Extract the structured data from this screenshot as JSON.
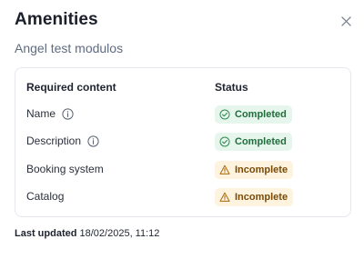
{
  "dialog": {
    "title": "Amenities",
    "subtitle": "Angel test modulos",
    "close_icon": "close-icon"
  },
  "table": {
    "headers": {
      "required_content": "Required content",
      "status": "Status"
    },
    "rows": [
      {
        "label": "Name",
        "has_info": true,
        "status": "Completed",
        "status_type": "success",
        "icon": "check-circle-icon"
      },
      {
        "label": "Description",
        "has_info": true,
        "status": "Completed",
        "status_type": "success",
        "icon": "check-circle-icon"
      },
      {
        "label": "Booking system",
        "has_info": false,
        "status": "Incomplete",
        "status_type": "warning",
        "icon": "warning-triangle-icon"
      },
      {
        "label": "Catalog",
        "has_info": false,
        "status": "Incomplete",
        "status_type": "warning",
        "icon": "warning-triangle-icon"
      }
    ]
  },
  "footer": {
    "label": "Last updated",
    "timestamp": "18/02/2025, 11:12"
  },
  "colors": {
    "success_bg": "#e7f6ec",
    "success_text": "#1e6e3c",
    "warning_bg": "#fdf3de",
    "warning_text": "#7a4a05"
  }
}
